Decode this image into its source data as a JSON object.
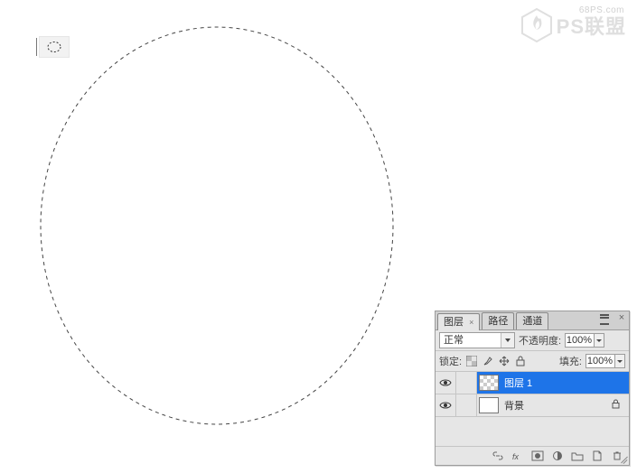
{
  "watermark": {
    "site": "68PS.com",
    "brand": "PS联盟"
  },
  "options_bar": {
    "tool": "elliptical-marquee"
  },
  "canvas": {
    "selection_shape": "ellipse"
  },
  "layers_panel": {
    "tabs": [
      {
        "label": "图层",
        "active": true
      },
      {
        "label": "路径",
        "active": false
      },
      {
        "label": "通道",
        "active": false
      }
    ],
    "blend_mode": "正常",
    "opacity_label": "不透明度:",
    "opacity_value": "100%",
    "lock_label": "锁定:",
    "fill_label": "填充:",
    "fill_value": "100%",
    "layers": [
      {
        "name": "图层 1",
        "transparent": true,
        "selected": true,
        "locked": false
      },
      {
        "name": "背景",
        "transparent": false,
        "selected": false,
        "locked": true
      }
    ]
  }
}
